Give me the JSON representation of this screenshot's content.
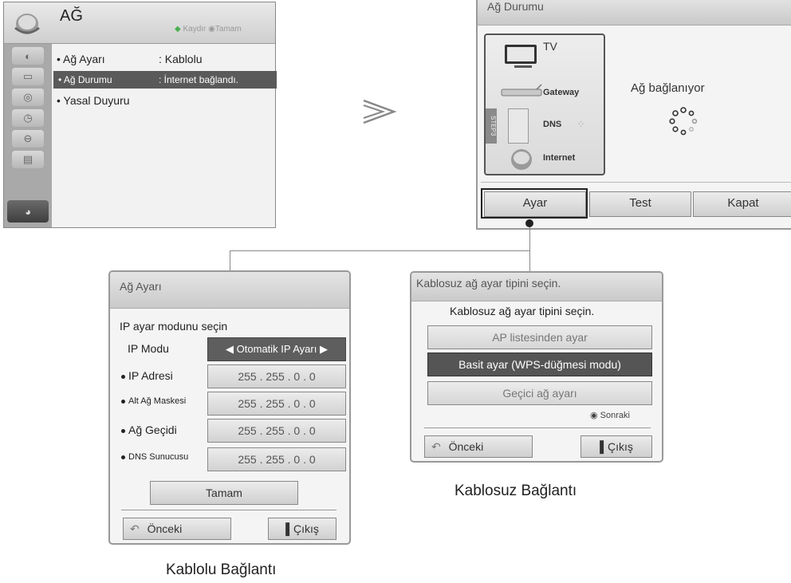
{
  "network_menu": {
    "title": "AĞ",
    "hint_scroll": "Kaydır",
    "hint_ok": "Tamam",
    "rows": [
      {
        "label": "• Ağ Ayarı",
        "value": ": Kablolu"
      },
      {
        "label": "• Ağ Durumu",
        "value": ": İnternet bağlandı."
      },
      {
        "label": "• Yasal Duyuru",
        "value": ""
      }
    ],
    "sidebar_icons": [
      "picture-icon",
      "monitor-icon",
      "audio-icon",
      "clock-icon",
      "lock-icon",
      "option-icon",
      "network-icon"
    ]
  },
  "network_status": {
    "title": "Ağ Durumu",
    "diagram": {
      "tv": "TV",
      "gateway": "Gateway",
      "dns": "DNS",
      "internet": "Internet",
      "step": "STEP3"
    },
    "message": "Ağ bağlanıyor",
    "buttons": {
      "setup": "Ayar",
      "test": "Test",
      "close": "Kapat"
    }
  },
  "wired_dialog": {
    "title": "Ağ Ayarı",
    "prompt": "IP ayar modunu seçin",
    "ip_mode_label": "IP Modu",
    "ip_mode_value": "◀ Otomatik IP Ayarı ▶",
    "fields": [
      {
        "label": "IP Adresi",
        "value": "255 . 255 . 0 . 0"
      },
      {
        "label": "Alt Ağ Maskesi",
        "value": "255 . 255 . 0 . 0"
      },
      {
        "label": "Ağ Geçidi",
        "value": "255 . 255 . 0 . 0"
      },
      {
        "label": "DNS Sunucusu",
        "value": "255 . 255 . 0 . 0"
      }
    ],
    "ok_button": "Tamam",
    "prev_button": "Önceki",
    "exit_button": "Çıkış"
  },
  "wireless_dialog": {
    "title": "Kablosuz ağ ayar tipini seçin.",
    "prompt": "Kablosuz ağ ayar tipini seçin.",
    "options": [
      "AP listesinden ayar",
      "Basit ayar (WPS-düğmesi modu)",
      "Geçici ağ ayarı"
    ],
    "next_hint": "Sonraki",
    "prev_button": "Önceki",
    "exit_button": "Çıkış"
  },
  "captions": {
    "wired": "Kablolu Bağlantı",
    "wireless": "Kablosuz Bağlantı"
  }
}
